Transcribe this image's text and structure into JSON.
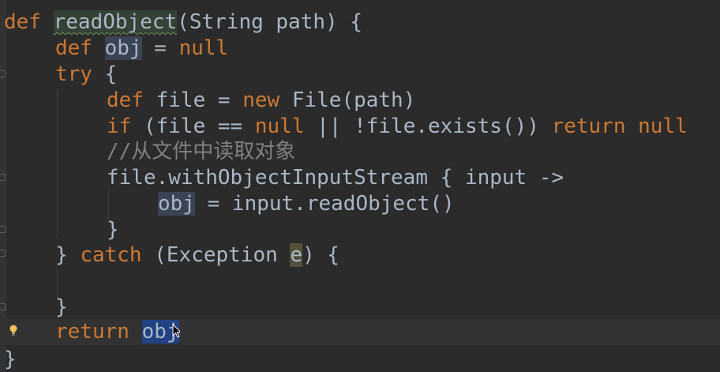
{
  "editor": {
    "language": "Groovy",
    "colors": {
      "background": "#2b2b2b",
      "keyword": "#cc7832",
      "text": "#a9b7c6",
      "comment": "#808080",
      "current_line": "#323232",
      "selection": "#214283",
      "usage_highlight": "#3b4454"
    },
    "lines": {
      "l1": {
        "kw": "def",
        "fn": "readObject",
        "rest": "(String path) {"
      },
      "l2": {
        "kw": "def",
        "var": "obj",
        "eq": " = ",
        "kw2": "null"
      },
      "l3": {
        "kw": "try",
        "rest": " {"
      },
      "l4": {
        "kw": "def",
        "mid": " file = ",
        "kw2": "new",
        "rest": " File(path)"
      },
      "l5": {
        "kw": "if",
        "mid": " (file == ",
        "kw2": "null",
        "mid2": " || !file.exists()) ",
        "kw3": "return",
        "sp": " ",
        "kw4": "null"
      },
      "l6": {
        "comment": "//从文件中读取对象"
      },
      "l7": {
        "text": "file.withObjectInputStream { input ->"
      },
      "l8": {
        "var": "obj",
        "rest": " = input.readObject()"
      },
      "l9": {
        "text": "}"
      },
      "l10": {
        "pre": "} ",
        "kw": "catch",
        "mid": " (Exception ",
        "param": "e",
        "rest": ") {"
      },
      "l11": {
        "text": "}"
      },
      "l12": {
        "kw": "return",
        "sp": " ",
        "var": "obj"
      },
      "l13": {
        "text": "}"
      }
    },
    "icons": {
      "intention": "lightbulb-icon",
      "pointer": "text-cursor-icon"
    }
  }
}
